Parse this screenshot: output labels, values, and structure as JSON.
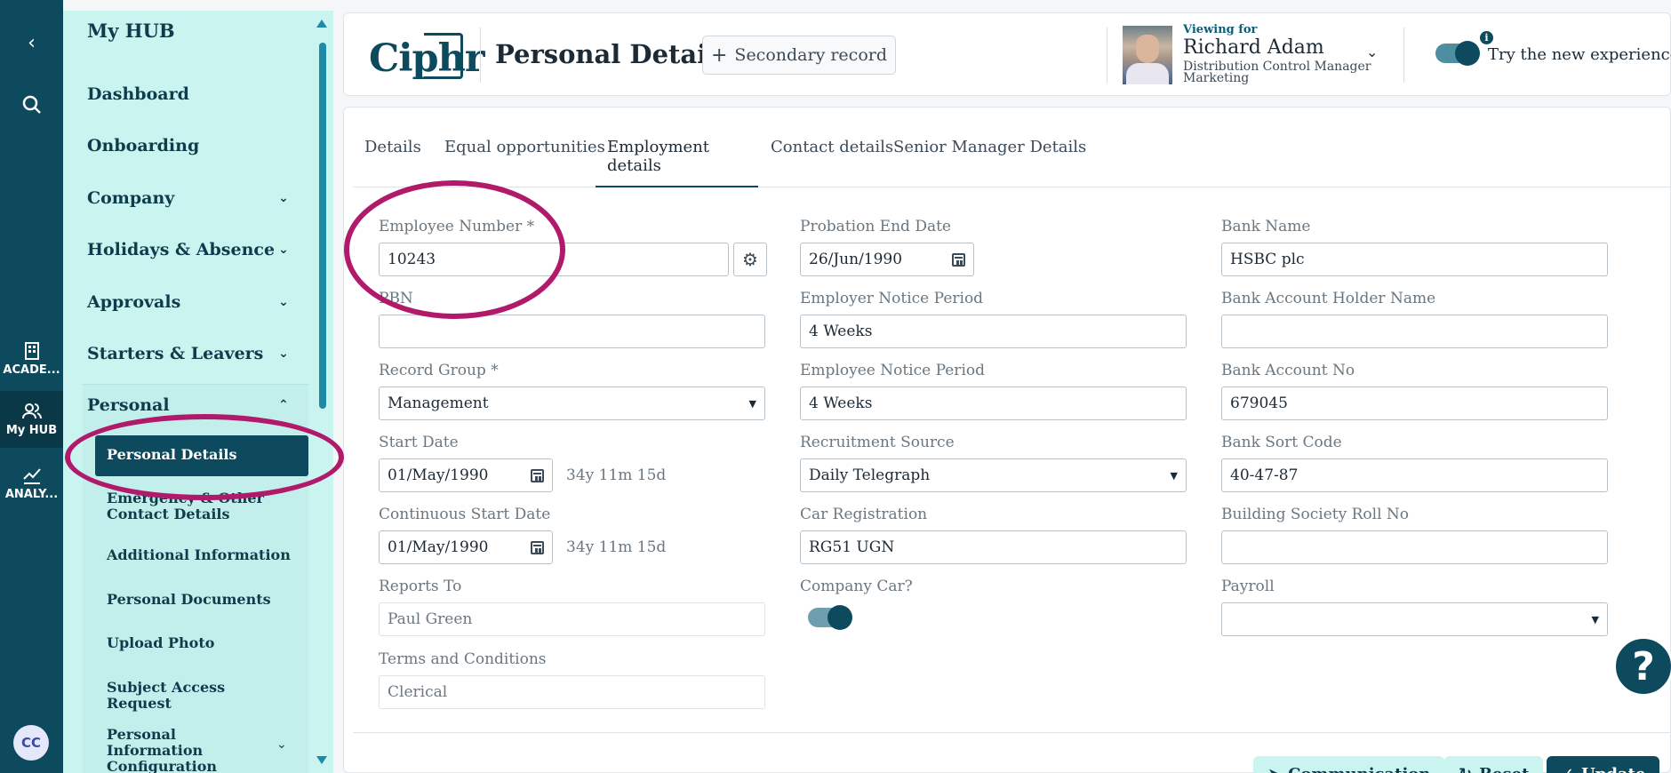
{
  "rail": {
    "back_icon": "chevron-left-icon",
    "search_icon": "search-icon",
    "items": [
      {
        "label": "ACADE...",
        "icon": "building-icon"
      },
      {
        "label": "My HUB",
        "icon": "users-icon"
      },
      {
        "label": "ANALY...",
        "icon": "chart-icon"
      }
    ],
    "avatar_initials": "CC"
  },
  "sidebar": {
    "title": "My HUB",
    "items": [
      {
        "label": "Dashboard"
      },
      {
        "label": "Onboarding"
      },
      {
        "label": "Company"
      },
      {
        "label": "Holidays & Absence"
      },
      {
        "label": "Approvals"
      },
      {
        "label": "Starters & Leavers"
      },
      {
        "label": "Personal"
      }
    ],
    "personal_sub": [
      {
        "label": "Personal Details"
      },
      {
        "label": "Emergency & Other Contact Details"
      },
      {
        "label": "Additional Information"
      },
      {
        "label": "Personal Documents"
      },
      {
        "label": "Upload Photo"
      },
      {
        "label": "Subject Access Request"
      },
      {
        "label": "Personal Information Configuration"
      }
    ]
  },
  "header": {
    "logo": "Ciphr",
    "title": "Personal Details",
    "secondary_record": "Secondary record",
    "viewing_for_label": "Viewing for",
    "viewing_name": "Richard Adam",
    "viewing_job": "Distribution Control Manager",
    "viewing_dept": "Marketing",
    "try_new": "Try the new experience",
    "info": "i"
  },
  "tabs": [
    {
      "label": "Details"
    },
    {
      "label": "Equal opportunities"
    },
    {
      "label": "Employment details"
    },
    {
      "label": "Contact details"
    },
    {
      "label": "Senior Manager Details"
    }
  ],
  "form": {
    "col1": {
      "employee_number": {
        "label": "Employee Number *",
        "value": "10243"
      },
      "pbn": {
        "label": "PBN",
        "value": ""
      },
      "record_group": {
        "label": "Record Group *",
        "value": "Management"
      },
      "start_date": {
        "label": "Start Date",
        "value": "01/May/1990",
        "duration": "34y 11m 15d"
      },
      "continuous_start": {
        "label": "Continuous Start Date",
        "value": "01/May/1990",
        "duration": "34y 11m 15d"
      },
      "reports_to": {
        "label": "Reports To",
        "value": "Paul Green"
      },
      "terms": {
        "label": "Terms and Conditions",
        "value": "Clerical"
      }
    },
    "col2": {
      "probation_end": {
        "label": "Probation End Date",
        "value": "26/Jun/1990"
      },
      "employer_notice": {
        "label": "Employer Notice Period",
        "value": "4 Weeks"
      },
      "employee_notice": {
        "label": "Employee Notice Period",
        "value": "4 Weeks"
      },
      "recruitment_source": {
        "label": "Recruitment Source",
        "value": "Daily Telegraph"
      },
      "car_registration": {
        "label": "Car Registration",
        "value": "RG51 UGN"
      },
      "company_car": {
        "label": "Company Car?",
        "value": true
      }
    },
    "col3": {
      "bank_name": {
        "label": "Bank Name",
        "value": "HSBC plc"
      },
      "account_holder": {
        "label": "Bank Account Holder Name",
        "value": ""
      },
      "account_no": {
        "label": "Bank Account No",
        "value": "679045"
      },
      "sort_code": {
        "label": "Bank Sort Code",
        "value": "40-47-87"
      },
      "building_society": {
        "label": "Building Society Roll No",
        "value": ""
      },
      "payroll": {
        "label": "Payroll",
        "value": ""
      }
    }
  },
  "footer": {
    "communication": "Communication",
    "reset": "Reset",
    "update": "Update"
  },
  "help": "?",
  "colors": {
    "brand": "#0d4a5e",
    "sidebar_bg": "#c9f4f0",
    "annotation": "#b11a6b"
  }
}
